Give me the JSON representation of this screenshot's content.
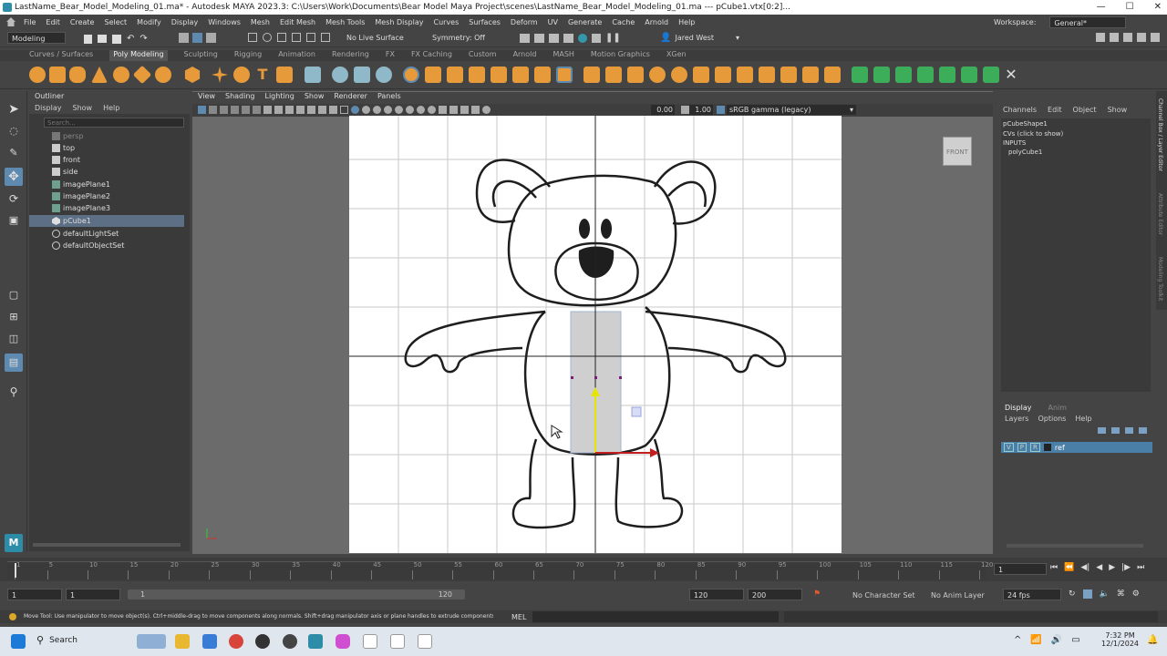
{
  "window": {
    "title": "LastName_Bear_Model_Modeling_01.ma* - Autodesk MAYA 2023.3: C:\\Users\\Work\\Documents\\Bear Model Maya Project\\scenes\\LastName_Bear_Model_Modeling_01.ma  ---  pCube1.vtx[0:2]...",
    "min": "—",
    "max": "☐",
    "close": "✕"
  },
  "menu": [
    "File",
    "Edit",
    "Create",
    "Select",
    "Modify",
    "Display",
    "Windows",
    "Mesh",
    "Edit Mesh",
    "Mesh Tools",
    "Mesh Display",
    "Curves",
    "Surfaces",
    "Deform",
    "UV",
    "Generate",
    "Cache",
    "Arnold",
    "Help"
  ],
  "workspace": {
    "label": "Workspace:",
    "value": "General*"
  },
  "statusline": {
    "menuset": "Modeling",
    "live": "No Live Surface",
    "symmetry": "Symmetry: Off",
    "user": "Jared West"
  },
  "shelf_tabs": [
    "Curves / Surfaces",
    "Poly Modeling",
    "Sculpting",
    "Rigging",
    "Animation",
    "Rendering",
    "FX",
    "FX Caching",
    "Custom",
    "Arnold",
    "MASH",
    "Motion Graphics",
    "XGen"
  ],
  "shelf_active": "Poly Modeling",
  "outliner": {
    "title": "Outliner",
    "menu": [
      "Display",
      "Show",
      "Help"
    ],
    "search_placeholder": "Search...",
    "items": [
      "persp",
      "top",
      "front",
      "side",
      "imagePlane1",
      "imagePlane2",
      "imagePlane3",
      "pCube1",
      "defaultLightSet",
      "defaultObjectSet"
    ],
    "selected": "pCube1"
  },
  "viewport": {
    "menu": [
      "View",
      "Shading",
      "Lighting",
      "Show",
      "Renderer",
      "Panels"
    ],
    "field1": "0.00",
    "field2": "1.00",
    "colorspace": "sRGB gamma (legacy)",
    "cam_label": "FRONT"
  },
  "channelbox": {
    "menu": [
      "Channels",
      "Edit",
      "Object",
      "Show"
    ],
    "shape": "pCubeShape1",
    "cvs": "CVs (click to show)",
    "inputs": "INPUTS",
    "input1": "polyCube1"
  },
  "side_tabs": [
    "Channel Box / Layer Editor",
    "Attribute Editor",
    "Modeling Toolkit"
  ],
  "layers": {
    "tabs": [
      "Display",
      "Anim"
    ],
    "menu": [
      "Layers",
      "Options",
      "Help"
    ],
    "layer": {
      "v": "V",
      "p": "P",
      "r": "R",
      "name": "ref"
    }
  },
  "timeline": {
    "ticks": [
      "1",
      "5",
      "10",
      "15",
      "20",
      "25",
      "30",
      "35",
      "40",
      "45",
      "50",
      "55",
      "60",
      "65",
      "70",
      "75",
      "80",
      "85",
      "90",
      "95",
      "100",
      "105",
      "110",
      "115",
      "120"
    ],
    "current": "1"
  },
  "range": {
    "start": "1",
    "start2": "1",
    "slider_start": "1",
    "slider_end": "120",
    "end": "120",
    "end2": "200",
    "char_set": "No Character Set",
    "anim_layer": "No Anim Layer",
    "fps": "24 fps"
  },
  "help": {
    "text": "Move Tool: Use manipulator to move object(s). Ctrl+middle-drag to move components along normals. Shift+drag manipulator axis or plane handles to extrude components or c",
    "mel": "MEL"
  },
  "taskbar": {
    "search": "Search",
    "time": "7:32 PM",
    "date": "12/1/2024"
  },
  "colors": {
    "accent": "#5d6f84",
    "selected_tab": "#4a7fa7",
    "layer_row": "#4a7fa7"
  }
}
